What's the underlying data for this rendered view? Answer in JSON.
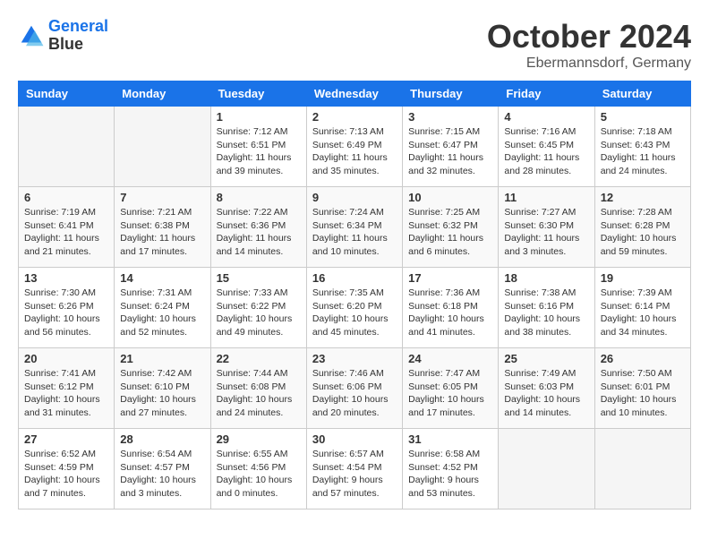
{
  "header": {
    "logo_line1": "General",
    "logo_line2": "Blue",
    "month": "October 2024",
    "location": "Ebermannsdorf, Germany"
  },
  "days_of_week": [
    "Sunday",
    "Monday",
    "Tuesday",
    "Wednesday",
    "Thursday",
    "Friday",
    "Saturday"
  ],
  "weeks": [
    [
      {
        "day": "",
        "info": ""
      },
      {
        "day": "",
        "info": ""
      },
      {
        "day": "1",
        "info": "Sunrise: 7:12 AM\nSunset: 6:51 PM\nDaylight: 11 hours and 39 minutes."
      },
      {
        "day": "2",
        "info": "Sunrise: 7:13 AM\nSunset: 6:49 PM\nDaylight: 11 hours and 35 minutes."
      },
      {
        "day": "3",
        "info": "Sunrise: 7:15 AM\nSunset: 6:47 PM\nDaylight: 11 hours and 32 minutes."
      },
      {
        "day": "4",
        "info": "Sunrise: 7:16 AM\nSunset: 6:45 PM\nDaylight: 11 hours and 28 minutes."
      },
      {
        "day": "5",
        "info": "Sunrise: 7:18 AM\nSunset: 6:43 PM\nDaylight: 11 hours and 24 minutes."
      }
    ],
    [
      {
        "day": "6",
        "info": "Sunrise: 7:19 AM\nSunset: 6:41 PM\nDaylight: 11 hours and 21 minutes."
      },
      {
        "day": "7",
        "info": "Sunrise: 7:21 AM\nSunset: 6:38 PM\nDaylight: 11 hours and 17 minutes."
      },
      {
        "day": "8",
        "info": "Sunrise: 7:22 AM\nSunset: 6:36 PM\nDaylight: 11 hours and 14 minutes."
      },
      {
        "day": "9",
        "info": "Sunrise: 7:24 AM\nSunset: 6:34 PM\nDaylight: 11 hours and 10 minutes."
      },
      {
        "day": "10",
        "info": "Sunrise: 7:25 AM\nSunset: 6:32 PM\nDaylight: 11 hours and 6 minutes."
      },
      {
        "day": "11",
        "info": "Sunrise: 7:27 AM\nSunset: 6:30 PM\nDaylight: 11 hours and 3 minutes."
      },
      {
        "day": "12",
        "info": "Sunrise: 7:28 AM\nSunset: 6:28 PM\nDaylight: 10 hours and 59 minutes."
      }
    ],
    [
      {
        "day": "13",
        "info": "Sunrise: 7:30 AM\nSunset: 6:26 PM\nDaylight: 10 hours and 56 minutes."
      },
      {
        "day": "14",
        "info": "Sunrise: 7:31 AM\nSunset: 6:24 PM\nDaylight: 10 hours and 52 minutes."
      },
      {
        "day": "15",
        "info": "Sunrise: 7:33 AM\nSunset: 6:22 PM\nDaylight: 10 hours and 49 minutes."
      },
      {
        "day": "16",
        "info": "Sunrise: 7:35 AM\nSunset: 6:20 PM\nDaylight: 10 hours and 45 minutes."
      },
      {
        "day": "17",
        "info": "Sunrise: 7:36 AM\nSunset: 6:18 PM\nDaylight: 10 hours and 41 minutes."
      },
      {
        "day": "18",
        "info": "Sunrise: 7:38 AM\nSunset: 6:16 PM\nDaylight: 10 hours and 38 minutes."
      },
      {
        "day": "19",
        "info": "Sunrise: 7:39 AM\nSunset: 6:14 PM\nDaylight: 10 hours and 34 minutes."
      }
    ],
    [
      {
        "day": "20",
        "info": "Sunrise: 7:41 AM\nSunset: 6:12 PM\nDaylight: 10 hours and 31 minutes."
      },
      {
        "day": "21",
        "info": "Sunrise: 7:42 AM\nSunset: 6:10 PM\nDaylight: 10 hours and 27 minutes."
      },
      {
        "day": "22",
        "info": "Sunrise: 7:44 AM\nSunset: 6:08 PM\nDaylight: 10 hours and 24 minutes."
      },
      {
        "day": "23",
        "info": "Sunrise: 7:46 AM\nSunset: 6:06 PM\nDaylight: 10 hours and 20 minutes."
      },
      {
        "day": "24",
        "info": "Sunrise: 7:47 AM\nSunset: 6:05 PM\nDaylight: 10 hours and 17 minutes."
      },
      {
        "day": "25",
        "info": "Sunrise: 7:49 AM\nSunset: 6:03 PM\nDaylight: 10 hours and 14 minutes."
      },
      {
        "day": "26",
        "info": "Sunrise: 7:50 AM\nSunset: 6:01 PM\nDaylight: 10 hours and 10 minutes."
      }
    ],
    [
      {
        "day": "27",
        "info": "Sunrise: 6:52 AM\nSunset: 4:59 PM\nDaylight: 10 hours and 7 minutes."
      },
      {
        "day": "28",
        "info": "Sunrise: 6:54 AM\nSunset: 4:57 PM\nDaylight: 10 hours and 3 minutes."
      },
      {
        "day": "29",
        "info": "Sunrise: 6:55 AM\nSunset: 4:56 PM\nDaylight: 10 hours and 0 minutes."
      },
      {
        "day": "30",
        "info": "Sunrise: 6:57 AM\nSunset: 4:54 PM\nDaylight: 9 hours and 57 minutes."
      },
      {
        "day": "31",
        "info": "Sunrise: 6:58 AM\nSunset: 4:52 PM\nDaylight: 9 hours and 53 minutes."
      },
      {
        "day": "",
        "info": ""
      },
      {
        "day": "",
        "info": ""
      }
    ]
  ]
}
